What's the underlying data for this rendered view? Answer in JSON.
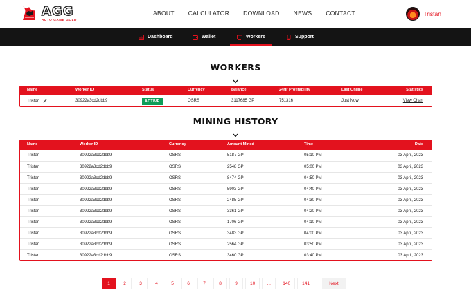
{
  "brand": {
    "title": "AGG",
    "subtitle": "AUTO GAME GOLD"
  },
  "topnav": [
    "ABOUT",
    "CALCULATOR",
    "DOWNLOAD",
    "NEWS",
    "CONTACT"
  ],
  "user": {
    "name": "Tristan"
  },
  "subnav": [
    "Dashboard",
    "Wallet",
    "Workers",
    "Support"
  ],
  "workers": {
    "title": "WORKERS",
    "headers": [
      "Name",
      "Worker ID",
      "Status",
      "Currency",
      "Balance",
      "24Hr Profitability",
      "Last Online",
      "Statistics"
    ],
    "row": {
      "name": "Tristan",
      "worker_id": "30922a3cd2dbb9",
      "status": "ACTIVE",
      "currency": "OSRS",
      "balance": "3117685 GP",
      "profit": "751316",
      "last_online": "Just Now",
      "stats_link": "View Chart"
    }
  },
  "history": {
    "title": "MINING HISTORY",
    "headers": [
      "Name",
      "Worker ID",
      "Currency",
      "Amount Mined",
      "Time",
      "Date"
    ],
    "rows": [
      [
        "Tristan",
        "30922a3cd2dbb9",
        "OSRS",
        "5187 GP",
        "05:10 PM",
        "03 April, 2023"
      ],
      [
        "Tristan",
        "30922a3cd2dbb9",
        "OSRS",
        "2548 GP",
        "05:00 PM",
        "03 April, 2023"
      ],
      [
        "Tristan",
        "30922a3cd2dbb9",
        "OSRS",
        "8474 GP",
        "04:50 PM",
        "03 April, 2023"
      ],
      [
        "Tristan",
        "30922a3cd2dbb9",
        "OSRS",
        "5903 GP",
        "04:40 PM",
        "03 April, 2023"
      ],
      [
        "Tristan",
        "30922a3cd2dbb9",
        "OSRS",
        "2485 GP",
        "04:30 PM",
        "03 April, 2023"
      ],
      [
        "Tristan",
        "30922a3cd2dbb9",
        "OSRS",
        "3361 GP",
        "04:20 PM",
        "03 April, 2023"
      ],
      [
        "Tristan",
        "30922a3cd2dbb9",
        "OSRS",
        "1706 GP",
        "04:10 PM",
        "03 April, 2023"
      ],
      [
        "Tristan",
        "30922a3cd2dbb9",
        "OSRS",
        "3483 GP",
        "04:00 PM",
        "03 April, 2023"
      ],
      [
        "Tristan",
        "30922a3cd2dbb9",
        "OSRS",
        "2564 GP",
        "03:50 PM",
        "03 April, 2023"
      ],
      [
        "Tristan",
        "30922a3cd2dbb9",
        "OSRS",
        "3460 GP",
        "03:40 PM",
        "03 April, 2023"
      ]
    ]
  },
  "pagination": {
    "pages": [
      "1",
      "2",
      "3",
      "4",
      "5",
      "6",
      "7",
      "8",
      "9",
      "10",
      "...",
      "140",
      "141"
    ],
    "current": "1",
    "next_label": "Next"
  },
  "colors": {
    "accent": "#e3121e",
    "dark": "#141414",
    "active_badge": "#0f9d58"
  }
}
